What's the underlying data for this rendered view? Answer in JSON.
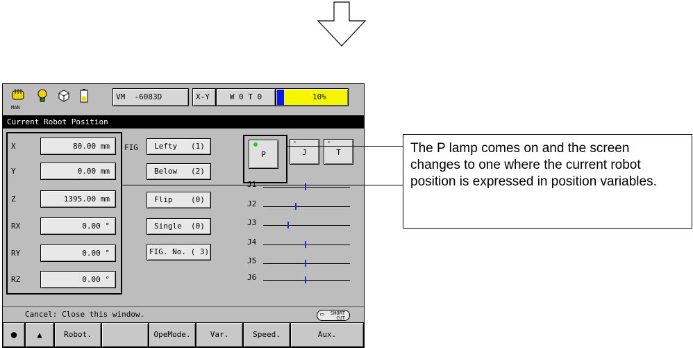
{
  "toolbar": {
    "mode_icon": "hand-icon",
    "mode_sub": "MAN",
    "model": "VM  -6083D",
    "coord_system": "X-Y",
    "tool_work": "W 0 T 0",
    "speed": "10%"
  },
  "title": "Current Robot Position",
  "coords": [
    {
      "label": "X",
      "value": "80.00 mm"
    },
    {
      "label": "Y",
      "value": "0.00 mm"
    },
    {
      "label": "Z",
      "value": "1395.00 mm"
    },
    {
      "label": "RX",
      "value": "0.00 °"
    },
    {
      "label": "RY",
      "value": "0.00 °"
    },
    {
      "label": "RZ",
      "value": "0.00 °"
    }
  ],
  "fig": {
    "label": "FIG",
    "buttons": [
      "Lefty   (1)",
      "Below   (2)",
      "Flip    (0)",
      "Single  (0)",
      "FIG. No. ( 3)"
    ]
  },
  "modes": {
    "p": "P",
    "j": "J",
    "t": "T",
    "active": "P",
    "lamp_color": "#22cc22"
  },
  "joints": {
    "labels": [
      "J1",
      "J2",
      "J3",
      "J4",
      "J5",
      "J6"
    ],
    "positions": [
      0.48,
      0.37,
      0.28,
      0.48,
      0.48,
      0.48
    ]
  },
  "status": {
    "message": "Cancel: Close this window.",
    "shortcut_line1": "SHORT",
    "shortcut_line2": "CUT"
  },
  "fkeys": {
    "f1": "Robot.",
    "f2": "",
    "f3": "OpeMode.",
    "f4": "Var.",
    "f5": "Speed.",
    "f6": "Aux."
  },
  "callout": {
    "text": "The P lamp comes on and the screen changes to one where the current robot position is expressed in position variables."
  }
}
